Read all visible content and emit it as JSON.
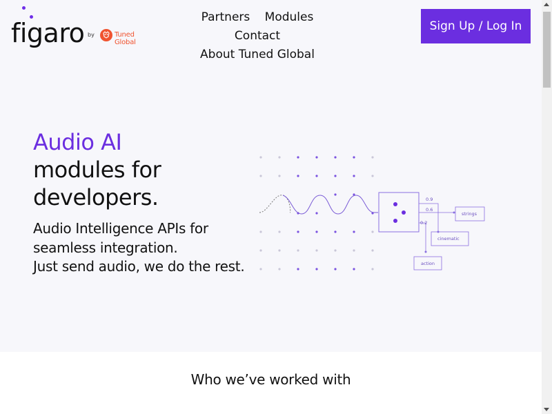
{
  "header": {
    "logo_text": "figaro",
    "logo_by": "by",
    "partner_logo_text": "Tuned Global",
    "nav": [
      "Partners",
      "Modules",
      "Contact",
      "About Tuned Global"
    ],
    "signup_label": "Sign Up / Log In"
  },
  "hero": {
    "title_accent": "Audio AI",
    "title_line2": "modules for",
    "title_line3": "developers.",
    "subtitle_lines": [
      "Audio Intelligence APIs for",
      "seamless integration.",
      "Just send audio, we do the rest."
    ]
  },
  "illustration": {
    "labels": [
      "strings",
      "cinematic",
      "action"
    ],
    "scores": [
      "0.9",
      "0.6",
      "0.2"
    ]
  },
  "section": {
    "worked_with_title": "Who we’ve worked with"
  },
  "colors": {
    "accent": "#6b2ee0",
    "brand_partner": "#f0532f",
    "hero_bg": "#f7f7fb"
  }
}
